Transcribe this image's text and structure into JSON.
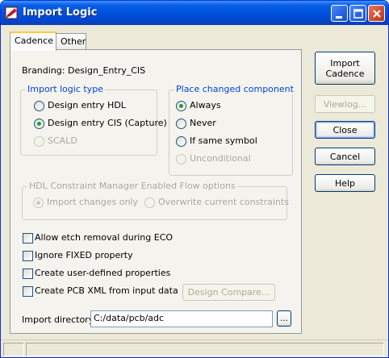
{
  "window": {
    "title": "Import Logic"
  },
  "tabs": [
    {
      "label": "Cadence",
      "active": true
    },
    {
      "label": "Other",
      "active": false
    }
  ],
  "branding": {
    "label": "Branding:",
    "value": "Design_Entry_CIS"
  },
  "import_logic_type": {
    "title": "Import logic type",
    "options": [
      {
        "label": "Design entry HDL",
        "checked": false,
        "enabled": true
      },
      {
        "label": "Design entry CIS (Capture)",
        "checked": true,
        "enabled": true
      },
      {
        "label": "SCALD",
        "checked": false,
        "enabled": false
      }
    ]
  },
  "place_changed_component": {
    "title": "Place changed component",
    "options": [
      {
        "label": "Always",
        "checked": true,
        "enabled": true
      },
      {
        "label": "Never",
        "checked": false,
        "enabled": true
      },
      {
        "label": "If same symbol",
        "checked": false,
        "enabled": true
      },
      {
        "label": "Unconditional",
        "checked": false,
        "enabled": false
      }
    ]
  },
  "hdl_flow": {
    "title": "HDL Constraint Manager Enabled Flow options",
    "options": [
      {
        "label": "Import changes only",
        "checked": true,
        "enabled": false
      },
      {
        "label": "Overwrite current constraints",
        "checked": false,
        "enabled": false
      }
    ]
  },
  "checkboxes": [
    {
      "label": "Allow etch removal during ECO",
      "checked": false
    },
    {
      "label": "Ignore FIXED property",
      "checked": false
    },
    {
      "label": "Create user-defined properties",
      "checked": false
    },
    {
      "label": "Create PCB XML from input data",
      "checked": false
    }
  ],
  "design_compare_label": "Design Compare...",
  "import_directory": {
    "label": "Import directory:",
    "value": "C:/data/pcb/adc",
    "browse_label": "..."
  },
  "side_buttons": {
    "import_line1": "Import",
    "import_line2": "Cadence",
    "viewlog": "Viewlog...",
    "close": "Close",
    "cancel": "Cancel",
    "help": "Help"
  }
}
